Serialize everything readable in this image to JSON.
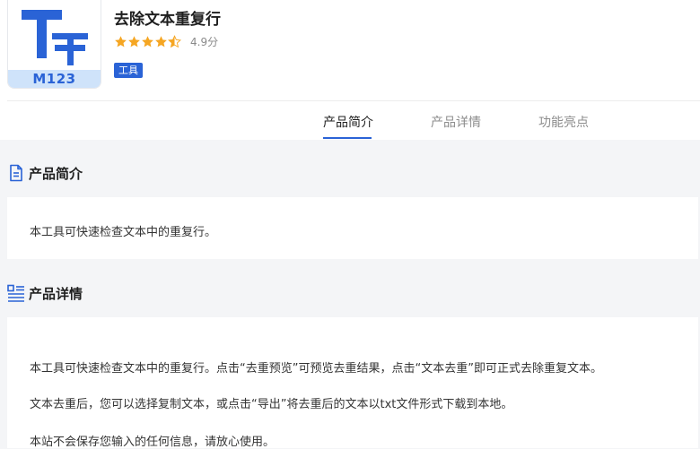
{
  "app": {
    "name": "去除文本重复行",
    "rating": 4.5,
    "score_text": "4.9分",
    "tag": "工具",
    "icon_brand": "M123",
    "colors": {
      "accent": "#2a63d6",
      "star": "#f5a623"
    }
  },
  "tabs": [
    {
      "label": "产品简介",
      "active": true
    },
    {
      "label": "产品详情",
      "active": false
    },
    {
      "label": "功能亮点",
      "active": false
    }
  ],
  "sections": {
    "intro": {
      "title": "产品简介",
      "icon": "document-icon",
      "text": "本工具可快速检查文本中的重复行。"
    },
    "details": {
      "title": "产品详情",
      "icon": "list-icon",
      "paragraphs": [
        "本工具可快速检查文本中的重复行。点击“去重预览”可预览去重结果，点击“文本去重”即可正式去除重复文本。",
        "文本去重后，您可以选择复制文本，或点击“导出”将去重后的文本以txt文件形式下载到本地。",
        "本站不会保存您输入的任何信息，请放心使用。"
      ]
    }
  }
}
